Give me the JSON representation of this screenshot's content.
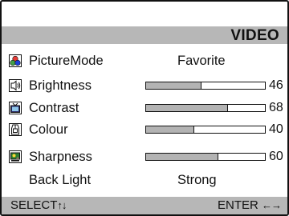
{
  "menu": {
    "title": "VIDEO",
    "items": [
      {
        "label": "PictureMode",
        "value": "Favorite",
        "icon": "picture-mode-icon"
      },
      {
        "label": "Brightness",
        "number": "46",
        "level": 46,
        "icon": "brightness-icon"
      },
      {
        "label": "Contrast",
        "number": "68",
        "level": 68,
        "icon": "contrast-icon"
      },
      {
        "label": "Colour",
        "number": "40",
        "level": 40,
        "icon": "colour-icon"
      },
      {
        "label": "Sharpness",
        "number": "60",
        "level": 60,
        "icon": "sharpness-icon"
      },
      {
        "label": "Back Light",
        "value": "Strong"
      }
    ]
  },
  "footer": {
    "select_label": "SELECT",
    "select_glyph": "↑↓",
    "enter_label": "ENTER",
    "enter_glyph": "←→"
  },
  "colors": {
    "bar_gray": "#b7b7b7",
    "slider_fill": "#b3b3b3",
    "border": "#111111"
  }
}
